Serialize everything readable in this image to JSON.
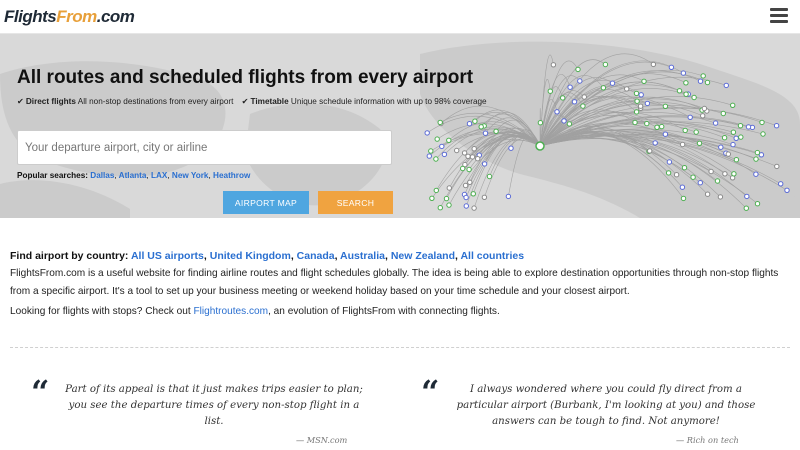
{
  "header": {
    "logo_part1": "Flights",
    "logo_part2": "From",
    "logo_part3": ".com"
  },
  "hero": {
    "title": "All routes and scheduled flights from every airport",
    "features": [
      {
        "name": "Direct flights",
        "desc": "All non-stop destinations from every airport"
      },
      {
        "name": "Timetable",
        "desc": "Unique schedule information with up to 98% coverage"
      }
    ],
    "search_placeholder": "Your departure airport, city or airline",
    "popular_label": "Popular searches:",
    "popular": [
      "Dallas",
      "Atlanta",
      "LAX",
      "New York",
      "Heathrow"
    ],
    "map_button": "AIRPORT MAP",
    "search_button": "SEARCH"
  },
  "content": {
    "country_label": "Find airport by country:",
    "countries": [
      "All US airports",
      "United Kingdom",
      "Canada",
      "Australia",
      "New Zealand",
      "All countries"
    ],
    "intro": "FlightsFrom.com is a useful website for finding airline routes and flight schedules globally. The idea is being able to explore destination opportunities through non-stop flights from a specific airport. It's a tool to set up your business meeting or weekend holiday based on your time schedule and your closest airport.",
    "stops_prefix": "Looking for flights with stops? Check out ",
    "stops_link": "Flightroutes.com",
    "stops_suffix": ", an evolution of FlightsFrom with connecting flights."
  },
  "quotes": [
    {
      "text": "Part of its appeal is that it just makes trips easier to plan; you see the departure times of every non-stop flight in a list.",
      "source": "— MSN.com"
    },
    {
      "text": "I always wondered where you could fly direct from a particular airport (Burbank, I'm looking at you) and those answers can be tough to find. Not anymore!",
      "source": "— Rich on tech"
    }
  ],
  "colors": {
    "accent_blue": "#4fa6e0",
    "accent_orange": "#f0a340",
    "link": "#2a6fd0"
  }
}
